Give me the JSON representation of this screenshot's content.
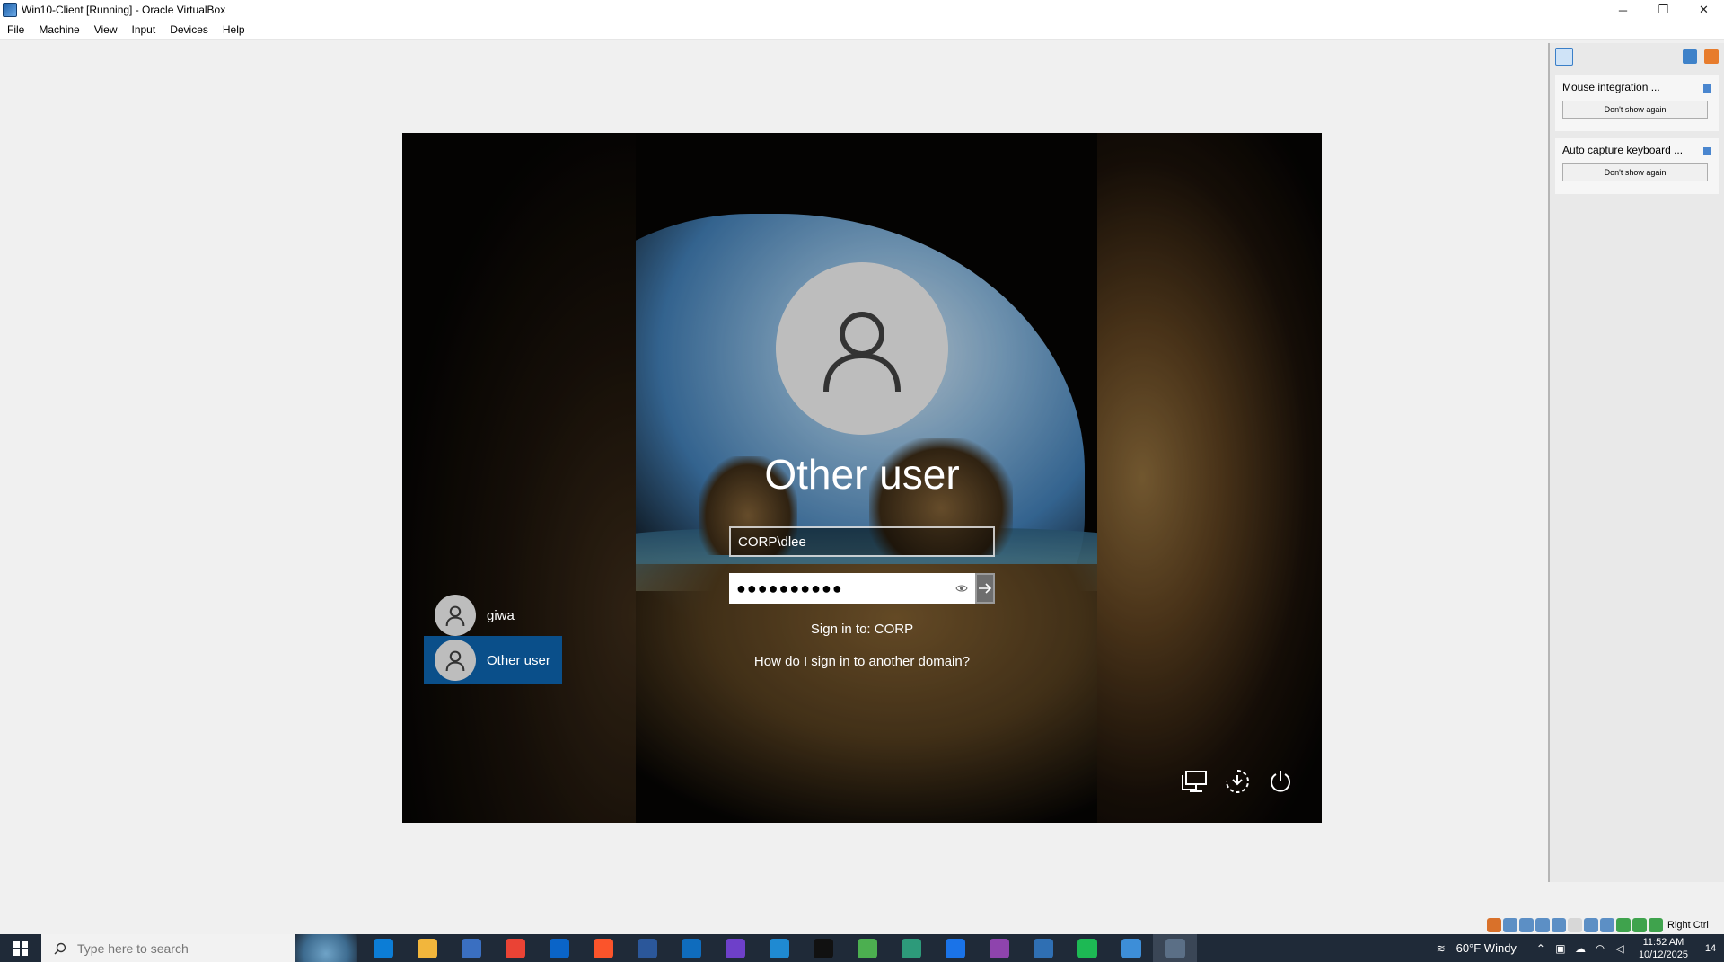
{
  "window": {
    "title": "Win10-Client [Running] - Oracle VirtualBox",
    "minimize": "─",
    "restore": "❐",
    "close": "✕"
  },
  "menu": [
    "File",
    "Machine",
    "View",
    "Input",
    "Devices",
    "Help"
  ],
  "login": {
    "title": "Other user",
    "username_value": "CORP\\dlee",
    "password_value": "●●●●●●●●●●",
    "sign_in_to": "Sign in to: CORP",
    "domain_link": "How do I sign in to another domain?"
  },
  "users": [
    {
      "name": "giwa",
      "selected": false
    },
    {
      "name": "Other user",
      "selected": true
    }
  ],
  "notifications": [
    {
      "title": "Mouse integration ...",
      "button": "Don't show again"
    },
    {
      "title": "Auto capture keyboard ...",
      "button": "Don't show again"
    }
  ],
  "status_bar": {
    "host_key": "Right Ctrl"
  },
  "taskbar": {
    "search_placeholder": "Type here to search",
    "weather": "60°F  Windy",
    "time": "11:52 AM",
    "date": "10/12/2025",
    "notification_count": "14",
    "icon_colors": [
      "#0c7dd6",
      "#f2b63c",
      "#3a6fc1",
      "#ea4335",
      "#0a64c8",
      "#fb542b",
      "#2b579a",
      "#0f6cbd",
      "#6e40c9",
      "#1f8ad2",
      "#111111",
      "#4caf50",
      "#2d9a7a",
      "#1a73e8",
      "#8e44ad",
      "#2f6fb3",
      "#1db954",
      "#3d8ed8",
      "#5b6f86"
    ]
  }
}
